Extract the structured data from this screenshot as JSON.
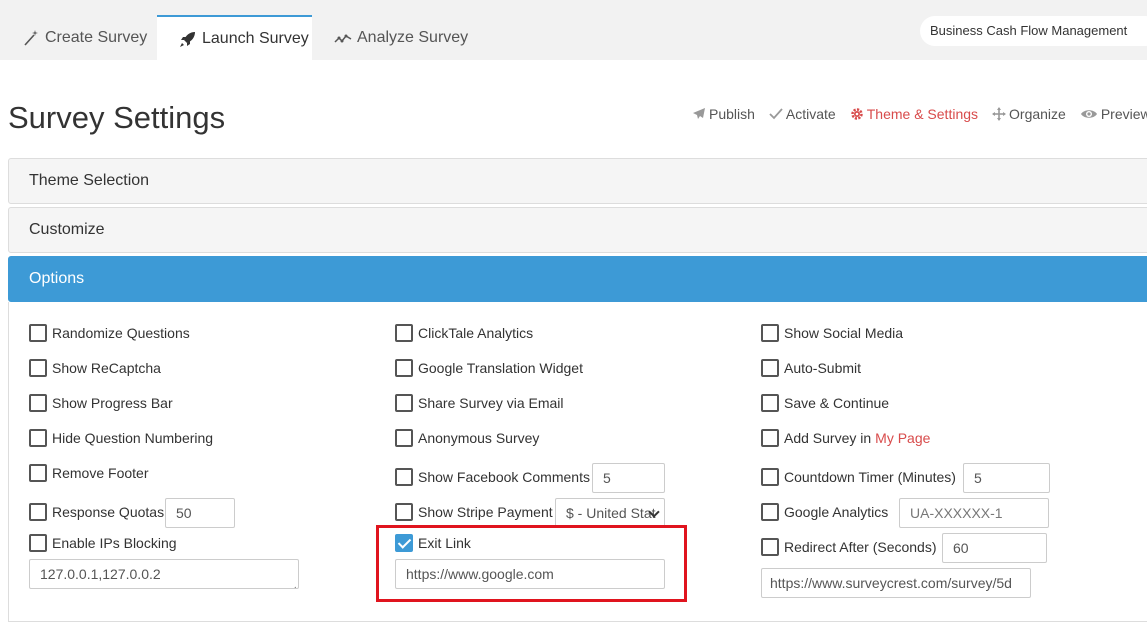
{
  "tabs": [
    {
      "label": "Create Survey",
      "icon": "magic-wand-icon",
      "active": false
    },
    {
      "label": "Launch Survey",
      "icon": "rocket-icon",
      "active": true
    },
    {
      "label": "Analyze Survey",
      "icon": "line-chart-icon",
      "active": false
    }
  ],
  "survey_name": "Business Cash Flow Management",
  "page_title": "Survey Settings",
  "steps": [
    {
      "label": "Publish",
      "icon": "paper-plane-icon"
    },
    {
      "label": "Activate",
      "icon": "check-icon"
    },
    {
      "label": "Theme & Settings",
      "icon": "gear-icon"
    },
    {
      "label": "Organize",
      "icon": "move-icon"
    },
    {
      "label": "Preview",
      "icon": "eye-icon"
    }
  ],
  "panels": {
    "theme": "Theme Selection",
    "customize": "Customize",
    "options": "Options"
  },
  "options": {
    "col1": {
      "randomize": "Randomize Questions",
      "recaptcha": "Show ReCaptcha",
      "progress": "Show Progress Bar",
      "hide_numbering": "Hide Question Numbering",
      "remove_footer": "Remove Footer",
      "quotas": "Response Quotas",
      "quotas_value": "50",
      "ip_blocking": "Enable IPs Blocking",
      "ip_list": "127.0.0.1,127.0.0.2"
    },
    "col2": {
      "clicktale": "ClickTale Analytics",
      "translation": "Google Translation Widget",
      "share_email": "Share Survey via Email",
      "anonymous": "Anonymous Survey",
      "facebook": "Show Facebook Comments",
      "facebook_value": "5",
      "stripe": "Show Stripe Payment",
      "stripe_currency": "$ - United Stat",
      "exit_link": "Exit Link",
      "exit_link_url": "https://www.google.com"
    },
    "col3": {
      "social": "Show Social Media",
      "auto_submit": "Auto-Submit",
      "save_continue": "Save & Continue",
      "add_survey": "Add Survey in",
      "my_page": "My Page",
      "countdown": "Countdown Timer (Minutes)",
      "countdown_value": "5",
      "analytics": "Google Analytics",
      "analytics_placeholder": "UA-XXXXXX-1",
      "redirect": "Redirect After (Seconds)",
      "redirect_value": "60",
      "redirect_url": "https://www.surveycrest.com/survey/5d"
    }
  },
  "colors": {
    "accent": "#3d9ad6",
    "active_step": "#d84b4b",
    "highlight": "#e0141e"
  }
}
